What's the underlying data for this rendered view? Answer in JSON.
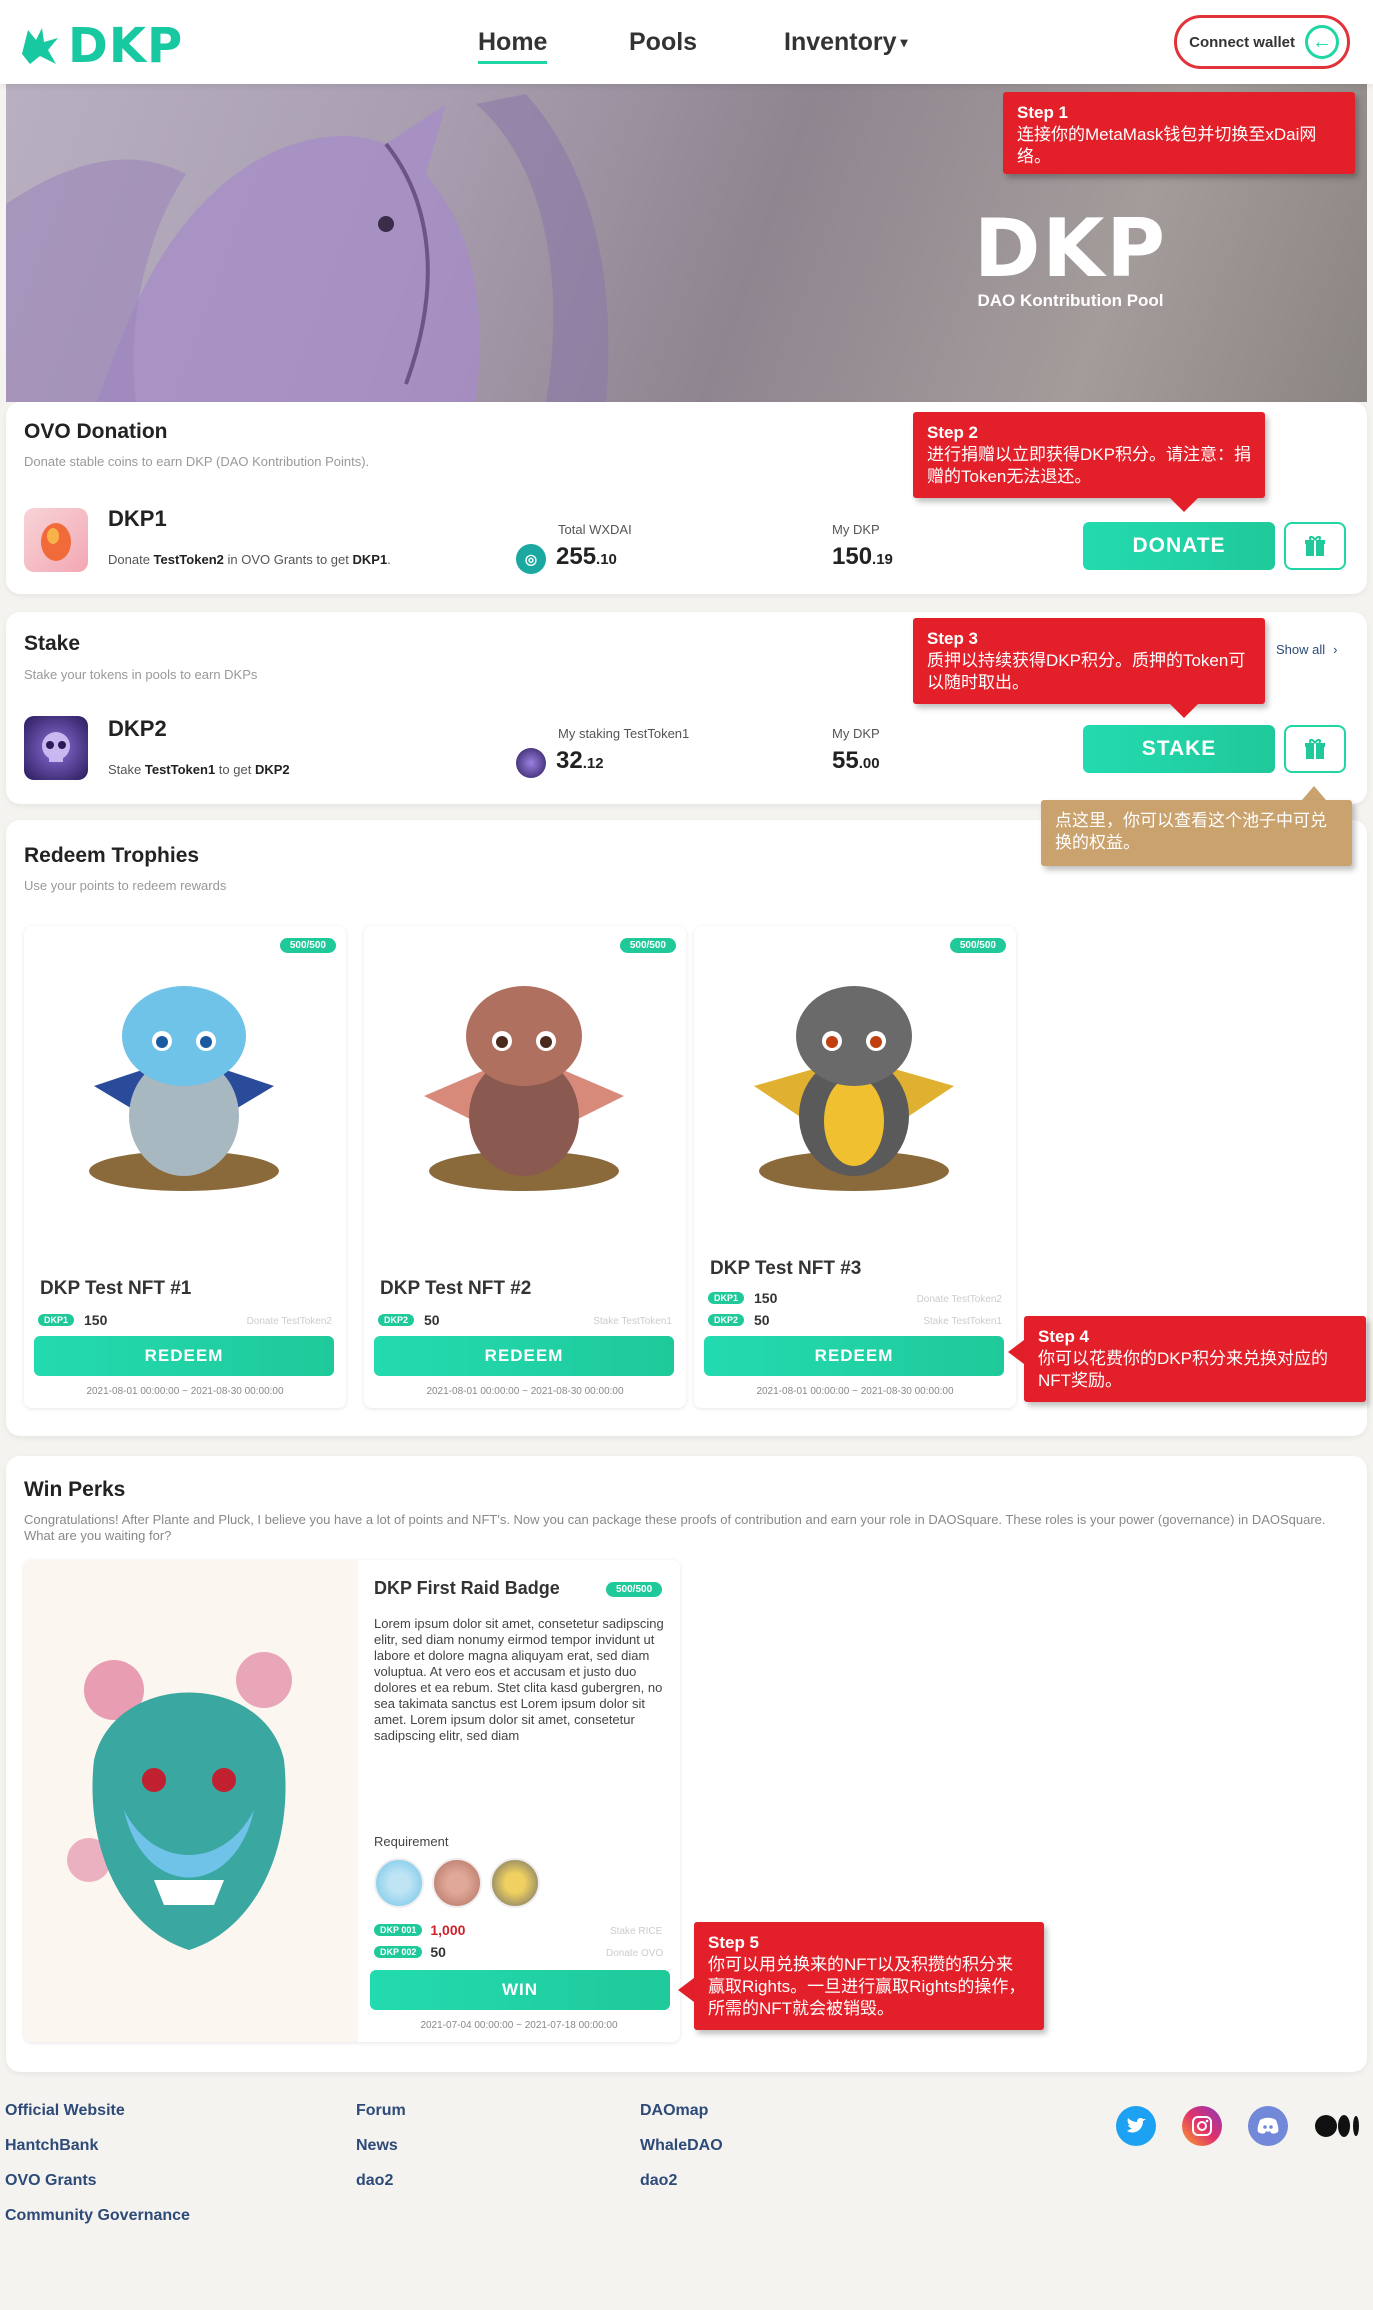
{
  "nav": {
    "brand": "DKP",
    "links": [
      "Home",
      "Pools",
      "Inventory"
    ],
    "inventory_caret": "▾",
    "wallet": "Connect wallet"
  },
  "hero": {
    "brand": "DKP",
    "tagline": "DAO Kontribution Pool"
  },
  "callouts": {
    "step1": {
      "title": "Step 1",
      "text": "连接你的MetaMask钱包并切换至xDai网络。"
    },
    "step2": {
      "title": "Step 2",
      "text": "进行捐赠以立即获得DKP积分。请注意：捐赠的Token无法退还。"
    },
    "step3": {
      "title": "Step 3",
      "text": "质押以持续获得DKP积分。质押的Token可以随时取出。"
    },
    "gift_tip": {
      "text": "点这里，你可以查看这个池子中可兑换的权益。"
    },
    "step4": {
      "title": "Step 4",
      "text": "你可以花费你的DKP积分来兑换对应的NFT奖励。"
    },
    "step5": {
      "title": "Step 5",
      "text": "你可以用兑换来的NFT以及积攒的积分来赢取Rights。一旦进行赢取Rights的操作，所需的NFT就会被销毁。"
    }
  },
  "donation": {
    "title": "OVO Donation",
    "subtitle": "Donate stable coins to earn DKP (DAO Kontribution Points).",
    "pool": {
      "name": "DKP1",
      "desc_pre": "Donate ",
      "desc_token": "TestToken2",
      "desc_mid": " in OVO Grants to get ",
      "desc_reward": "DKP1",
      "desc_end": "."
    },
    "total_label": "Total WXDAI",
    "total_int": "255",
    "total_dec": ".10",
    "my_label": "My DKP",
    "my_int": "150",
    "my_dec": ".19",
    "button": "DONATE"
  },
  "stake": {
    "title": "Stake",
    "subtitle": "Stake your tokens in pools to earn DKPs",
    "show_all": "Show all",
    "show_all_chevron": "›",
    "pool": {
      "name": "DKP2",
      "desc_pre": "Stake ",
      "desc_token": "TestToken1",
      "desc_mid": " to get ",
      "desc_reward": "DKP2"
    },
    "staking_label": "My staking TestToken1",
    "staking_int": "32",
    "staking_dec": ".12",
    "my_label": "My DKP",
    "my_int": "55",
    "my_dec": ".00",
    "button": "STAKE"
  },
  "redeem": {
    "title": "Redeem Trophies",
    "subtitle": "Use your points to redeem rewards",
    "items": [
      {
        "badge": "500/500",
        "name": "DKP Test NFT #1",
        "reqs": [
          {
            "chip": "DKP1",
            "value": "150",
            "note": "Donate TestToken2"
          }
        ],
        "button": "REDEEM",
        "date": "2021-08-01 00:00:00 ~ 2021-08-30 00:00:00",
        "color": "#6fc3e8"
      },
      {
        "badge": "500/500",
        "name": "DKP Test NFT #2",
        "reqs": [
          {
            "chip": "DKP2",
            "value": "50",
            "note": "Stake TestToken1"
          }
        ],
        "button": "REDEEM",
        "date": "2021-08-01 00:00:00 ~ 2021-08-30 00:00:00",
        "color": "#b07060"
      },
      {
        "badge": "500/500",
        "name": "DKP Test NFT #3",
        "reqs": [
          {
            "chip": "DKP1",
            "value": "150",
            "note": "Donate TestToken2"
          },
          {
            "chip": "DKP2",
            "value": "50",
            "note": "Stake TestToken1"
          }
        ],
        "button": "REDEEM",
        "date": "2021-08-01 00:00:00 ~ 2021-08-30 00:00:00",
        "color": "#e0b030"
      }
    ]
  },
  "perks": {
    "title": "Win Perks",
    "subtitle": "Congratulations! After Plante and Pluck, I believe you have a lot of points and NFT's. Now you can package these proofs of contribution and earn your role in DAOSquare. These roles is your power (governance) in DAOSquare. What are you waiting for?",
    "badge_name": "DKP First Raid Badge",
    "badge": "500/500",
    "lorem": "Lorem ipsum dolor sit amet, consetetur sadipscing elitr, sed diam nonumy eirmod tempor invidunt ut labore et dolore magna aliquyam erat, sed diam voluptua. At vero eos et accusam et justo duo dolores et ea rebum. Stet clita kasd gubergren, no sea takimata sanctus est Lorem ipsum dolor sit amet. Lorem ipsum dolor sit amet, consetetur sadipscing elitr, sed diam",
    "requirement_label": "Requirement",
    "reqs": [
      {
        "chip": "DKP 001",
        "value": "1,000",
        "note": "Stake RICE"
      },
      {
        "chip": "DKP 002",
        "value": "50",
        "note": "Donate OVO"
      }
    ],
    "button": "WIN",
    "date": "2021-07-04 00:00:00 ~ 2021-07-18 00:00:00"
  },
  "footer": {
    "col1": [
      "Official Website",
      "HantchBank",
      "OVO Grants",
      "Community Governance"
    ],
    "col2": [
      "Forum",
      "News",
      "dao2"
    ],
    "col3": [
      "DAOmap",
      "WhaleDAO",
      "dao2"
    ],
    "social": [
      "twitter-icon",
      "instagram-icon",
      "discord-icon",
      "medium-icon"
    ]
  }
}
